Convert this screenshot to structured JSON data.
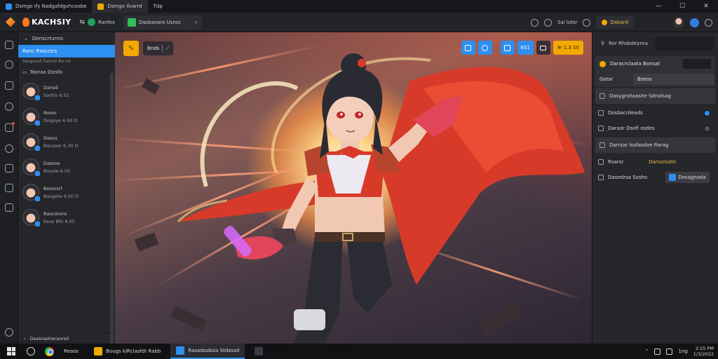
{
  "window": {
    "tabs": [
      {
        "label": "Dsmgo Ify Nadgafdgvhcoobe",
        "active": false
      },
      {
        "label": "Dsmgo Ilvarrd",
        "active": true
      },
      {
        "label": "Tdp",
        "active": false
      }
    ],
    "controls": {
      "minimize": "—",
      "maximize": "☐",
      "close": "✕"
    }
  },
  "appbar": {
    "brand": "KACHSIY",
    "refresh_label": "Ranfes",
    "tab_label": "Dasbaoaro Usnsc",
    "tab_close": "×",
    "right_items": [
      "Sal lotsr",
      "Dabard"
    ]
  },
  "left_panel": {
    "header": "Denscrtunns",
    "active_item": "Ranc Rsocctrs",
    "sub_item": "Sasgarsd Sanclo Ra ral",
    "section_title": "Tooraa Dsnlls",
    "contacts": [
      {
        "name": "Dansd",
        "status": "Sarltis 6.51"
      },
      {
        "name": "Roosc",
        "status": "Dogoye 6.00 D"
      },
      {
        "name": "Dasos",
        "status": "Bocaser 6.30 D"
      },
      {
        "name": "Dassoe",
        "status": "Bosale 6.05"
      },
      {
        "name": "Besorsrl",
        "status": "Basgete 9.00 D"
      },
      {
        "name": "Rascotons",
        "status": "Esoe Bfo 6.05"
      }
    ],
    "footer": "Dassrastreraorsit"
  },
  "viewer": {
    "left_tools": {
      "name_label": "Bnds"
    },
    "right_tools": {
      "counter": "6S1",
      "zoom": "1.3 S0"
    }
  },
  "right_panel": {
    "title": "Ror Rhsbdeynra",
    "card_title": "Daracrclaata Bonsat",
    "card_label": "Gotsr",
    "card_value": "Bseos",
    "rows": [
      {
        "label": "Dasygrshaashe Sdnolsag",
        "highlight": true,
        "toggle": null
      },
      {
        "label": "Dosbacrdeads",
        "highlight": false,
        "toggle": "on"
      },
      {
        "label": "Daraar Dsofi osdes",
        "highlight": false,
        "toggle": "off"
      },
      {
        "label": "Darrsar lsofasdoe Rarag",
        "highlight": true,
        "toggle": null
      }
    ],
    "detail_1": {
      "label": "Rsarsr",
      "value": "Dansolsate"
    },
    "detail_2": {
      "label": "Dasedrsa Sosho",
      "value": "Desagnoda"
    }
  },
  "taskbar": {
    "apps": [
      {
        "label": "Reaos",
        "active": false
      },
      {
        "label": "Bougs kiRclasfdr Rabb",
        "active": false
      },
      {
        "label": "Rasadssbsia Stdassd",
        "active": true
      }
    ],
    "tray_lang": "1ng",
    "clock_time": "2:25 PM",
    "clock_date": "1/3/2022"
  },
  "colors": {
    "accent": "#2d8ff0",
    "brand": "#f2a900",
    "active_tab": "#2fbf5b"
  }
}
